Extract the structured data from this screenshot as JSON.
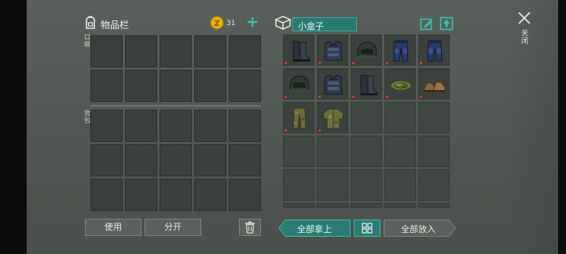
{
  "inventory": {
    "title": "物品栏",
    "coins": "31",
    "pocket_label": "口袋",
    "backpack_label": "背包"
  },
  "container": {
    "name": "小盒子"
  },
  "buttons": {
    "use": "使用",
    "split": "分开",
    "take_all": "全部拿上",
    "put_all": "全部放入",
    "close": "关闭"
  },
  "items": [
    {
      "name": "boots-icon"
    },
    {
      "name": "armor-vest-icon"
    },
    {
      "name": "helmet-icon"
    },
    {
      "name": "armored-pants-icon"
    },
    {
      "name": "armored-pants-icon"
    },
    {
      "name": "helmet-icon"
    },
    {
      "name": "armor-vest-icon"
    },
    {
      "name": "boots-icon"
    },
    {
      "name": "camo-cap-icon"
    },
    {
      "name": "leather-shoes-icon"
    },
    {
      "name": "camo-pants-icon"
    },
    {
      "name": "camo-jacket-icon"
    }
  ],
  "colors": {
    "accent_teal": "#35c3b3",
    "coin_gold": "#e8b400",
    "durability_red": "#d23b2b"
  }
}
